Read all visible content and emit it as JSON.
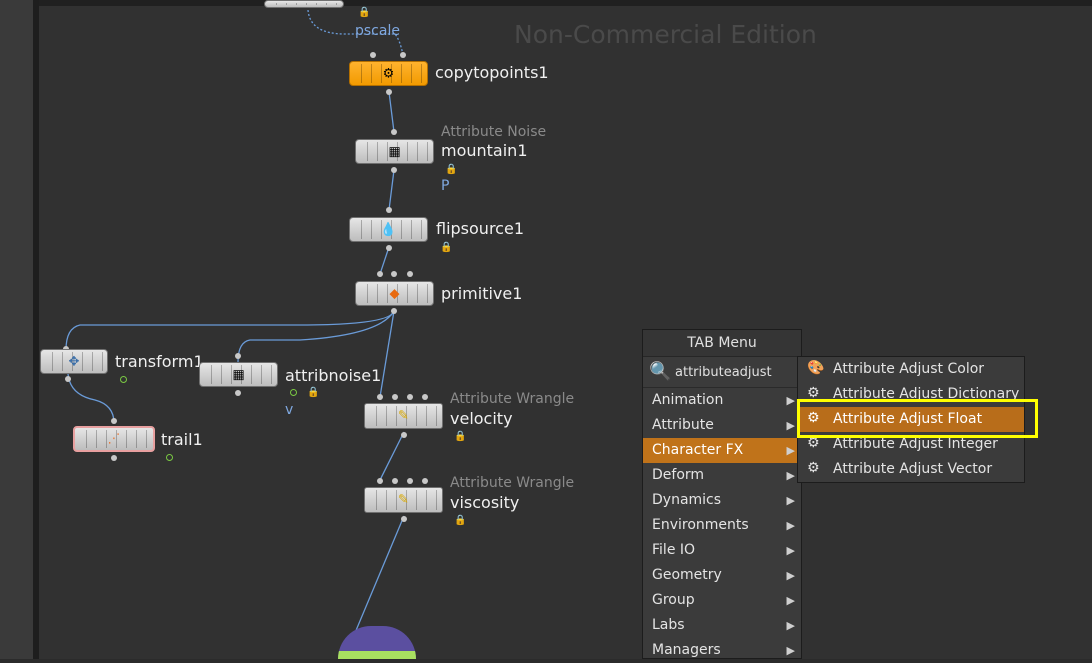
{
  "watermark": "Non-Commercial Edition",
  "nodes": {
    "copytopoints": {
      "label": "copytopoints1"
    },
    "mountain": {
      "type": "Attribute Noise",
      "label": "mountain1",
      "attr": "P"
    },
    "flipsource": {
      "label": "flipsource1"
    },
    "primitive": {
      "label": "primitive1"
    },
    "transform": {
      "label": "transform1"
    },
    "attribnoise": {
      "label": "attribnoise1",
      "attr": "v"
    },
    "velocity": {
      "type": "Attribute Wrangle",
      "label": "velocity"
    },
    "viscosity": {
      "type": "Attribute Wrangle",
      "label": "viscosity"
    },
    "trail": {
      "label": "trail1"
    }
  },
  "wire_labels": {
    "pscale": "pscale"
  },
  "tab_menu": {
    "title": "TAB Menu",
    "search_value": "attributeadjust",
    "items": [
      {
        "label": "Animation"
      },
      {
        "label": "Attribute"
      },
      {
        "label": "Character FX"
      },
      {
        "label": "Deform"
      },
      {
        "label": "Dynamics"
      },
      {
        "label": "Environments"
      },
      {
        "label": "File IO"
      },
      {
        "label": "Geometry"
      },
      {
        "label": "Group"
      },
      {
        "label": "Labs"
      },
      {
        "label": "Managers"
      }
    ],
    "selected": "Character FX"
  },
  "submenu": {
    "items": [
      {
        "label": "Attribute Adjust Color",
        "icon": "color-adjust-icon"
      },
      {
        "label": "Attribute Adjust Dictionary",
        "icon": "dictionary-adjust-icon"
      },
      {
        "label": "Attribute Adjust Float",
        "icon": "float-adjust-icon"
      },
      {
        "label": "Attribute Adjust Integer",
        "icon": "integer-adjust-icon"
      },
      {
        "label": "Attribute Adjust Vector",
        "icon": "vector-adjust-icon"
      }
    ],
    "selected": "Attribute Adjust Float"
  },
  "colors": {
    "accent": "#c0731a",
    "highlight": "#ffff00",
    "node_orange": "#f29a00",
    "attr_blue": "#7fa8e0"
  }
}
